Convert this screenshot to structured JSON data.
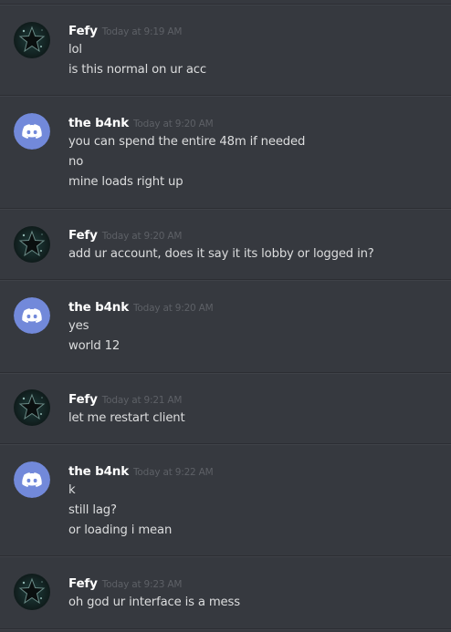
{
  "messages": [
    {
      "author": "Fefy",
      "avatar": "fefy-avatar",
      "timestamp": "Today at 9:19 AM",
      "lines": [
        "lol",
        "is this normal on ur acc"
      ]
    },
    {
      "author": "the b4nk",
      "avatar": "discord-default-avatar",
      "timestamp": "Today at 9:20 AM",
      "lines": [
        "you can spend the entire 48m if needed",
        "no",
        "mine loads right up"
      ]
    },
    {
      "author": "Fefy",
      "avatar": "fefy-avatar",
      "timestamp": "Today at 9:20 AM",
      "lines": [
        "add ur account, does it say it its lobby or logged in?"
      ]
    },
    {
      "author": "the b4nk",
      "avatar": "discord-default-avatar",
      "timestamp": "Today at 9:20 AM",
      "lines": [
        "yes",
        "world 12"
      ]
    },
    {
      "author": "Fefy",
      "avatar": "fefy-avatar",
      "timestamp": "Today at 9:21 AM",
      "lines": [
        "let me restart client"
      ]
    },
    {
      "author": "the b4nk",
      "avatar": "discord-default-avatar",
      "timestamp": "Today at 9:22 AM",
      "lines": [
        "k",
        "still lag?",
        "or loading i mean"
      ]
    },
    {
      "author": "Fefy",
      "avatar": "fefy-avatar",
      "timestamp": "Today at 9:23 AM",
      "lines": [
        "oh god ur interface is a mess"
      ]
    }
  ],
  "colors": {
    "background": "#36393f",
    "username": "#ffffff",
    "timestamp": "#5d6066",
    "text": "#dcddde",
    "discord_blurple": "#7289da",
    "divider": "#2c2e33"
  }
}
